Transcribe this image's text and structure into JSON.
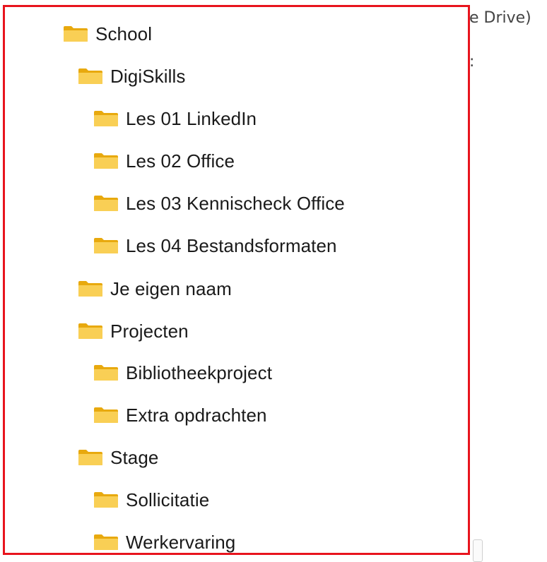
{
  "background": {
    "line1": "e Drive)",
    "line2": ":"
  },
  "colors": {
    "highlight_border": "#e8141d",
    "folder_back": "#e8a90e",
    "folder_front": "#f9cf55"
  },
  "tree": {
    "items": [
      {
        "label": "School",
        "icon": "folder-icon",
        "level": 0
      },
      {
        "label": "DigiSkills",
        "icon": "folder-icon",
        "level": 1
      },
      {
        "label": "Les 01 LinkedIn",
        "icon": "folder-icon",
        "level": 2
      },
      {
        "label": "Les 02 Office",
        "icon": "folder-icon",
        "level": 2
      },
      {
        "label": "Les 03 Kennischeck Office",
        "icon": "folder-icon",
        "level": 2
      },
      {
        "label": "Les 04 Bestandsformaten",
        "icon": "folder-icon",
        "level": 2
      },
      {
        "label": "Je eigen naam",
        "icon": "folder-icon",
        "level": 1
      },
      {
        "label": "Projecten",
        "icon": "folder-icon",
        "level": 1
      },
      {
        "label": "Bibliotheekproject",
        "icon": "folder-icon",
        "level": 2
      },
      {
        "label": "Extra opdrachten",
        "icon": "folder-icon",
        "level": 2
      },
      {
        "label": "Stage",
        "icon": "folder-icon",
        "level": 1
      },
      {
        "label": "Sollicitatie",
        "icon": "folder-icon",
        "level": 2
      },
      {
        "label": "Werkervaring",
        "icon": "folder-icon",
        "level": 2
      }
    ]
  }
}
